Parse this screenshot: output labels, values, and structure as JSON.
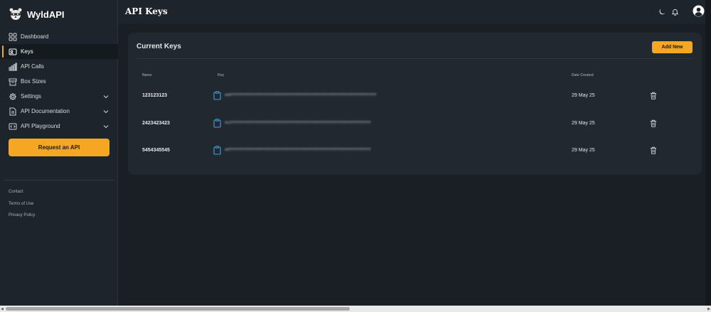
{
  "brand": {
    "name": "WyldAPI",
    "logo_icon": "raccoon-logo"
  },
  "sidebar": {
    "items": [
      {
        "label": "Dashboard",
        "icon": "grid-icon",
        "active": false,
        "expandable": false
      },
      {
        "label": "Keys",
        "icon": "key-card-icon",
        "active": true,
        "expandable": false
      },
      {
        "label": "API Calls",
        "icon": "bar-chart-icon",
        "active": false,
        "expandable": false
      },
      {
        "label": "Box Sizes",
        "icon": "box-icon",
        "active": false,
        "expandable": false
      },
      {
        "label": "Settings",
        "icon": "gear-icon",
        "active": false,
        "expandable": true
      },
      {
        "label": "API Documentation",
        "icon": "document-icon",
        "active": false,
        "expandable": true
      },
      {
        "label": "API Playground",
        "icon": "code-icon",
        "active": false,
        "expandable": true
      }
    ],
    "cta_label": "Request an API",
    "footer_links": [
      "Contact",
      "Terms of Use",
      "Privacy Policy"
    ]
  },
  "header": {
    "title": "API Keys",
    "icons": [
      "moon-icon",
      "bell-icon",
      "user-avatar-icon"
    ]
  },
  "keys_card": {
    "title": "Current Keys",
    "add_label": "Add New",
    "columns": {
      "name": "Name",
      "key": "Key",
      "date": "Date Created"
    },
    "rows": [
      {
        "name": "123123123",
        "key": "ed4fffffffffffffffffffffffffffffffffffffffffffffffffffffffffffffffffffffffffffffff",
        "date": "29 May 25"
      },
      {
        "name": "2423423423",
        "key": "d11ffffffffffffffffffffffffffffffffffffffffffffffffffffffffffffffffffffffffffff",
        "date": "29 May 25"
      },
      {
        "name": "5454345545",
        "key": "edfffffffffffffffffffffffffffffffffffffffffffffffffffffffffffffffffffffffffffff",
        "date": "29 May 25"
      }
    ]
  },
  "colors": {
    "accent": "#f5a623",
    "background": "#1a1f26",
    "card": "#22282f",
    "clipboard": "#3aa3d6"
  }
}
